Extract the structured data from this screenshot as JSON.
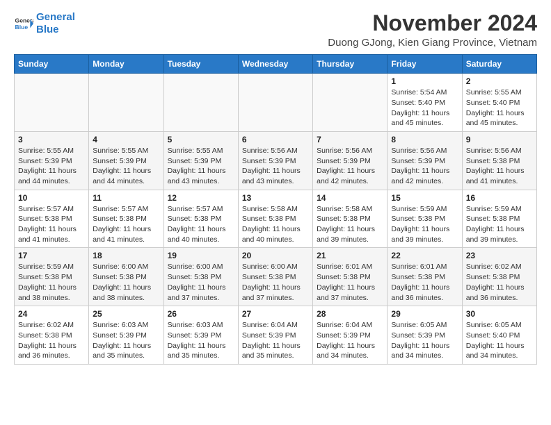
{
  "header": {
    "logo_line1": "General",
    "logo_line2": "Blue",
    "month_title": "November 2024",
    "subtitle": "Duong GJong, Kien Giang Province, Vietnam"
  },
  "weekdays": [
    "Sunday",
    "Monday",
    "Tuesday",
    "Wednesday",
    "Thursday",
    "Friday",
    "Saturday"
  ],
  "weeks": [
    [
      {
        "day": "",
        "info": ""
      },
      {
        "day": "",
        "info": ""
      },
      {
        "day": "",
        "info": ""
      },
      {
        "day": "",
        "info": ""
      },
      {
        "day": "",
        "info": ""
      },
      {
        "day": "1",
        "info": "Sunrise: 5:54 AM\nSunset: 5:40 PM\nDaylight: 11 hours and 45 minutes."
      },
      {
        "day": "2",
        "info": "Sunrise: 5:55 AM\nSunset: 5:40 PM\nDaylight: 11 hours and 45 minutes."
      }
    ],
    [
      {
        "day": "3",
        "info": "Sunrise: 5:55 AM\nSunset: 5:39 PM\nDaylight: 11 hours and 44 minutes."
      },
      {
        "day": "4",
        "info": "Sunrise: 5:55 AM\nSunset: 5:39 PM\nDaylight: 11 hours and 44 minutes."
      },
      {
        "day": "5",
        "info": "Sunrise: 5:55 AM\nSunset: 5:39 PM\nDaylight: 11 hours and 43 minutes."
      },
      {
        "day": "6",
        "info": "Sunrise: 5:56 AM\nSunset: 5:39 PM\nDaylight: 11 hours and 43 minutes."
      },
      {
        "day": "7",
        "info": "Sunrise: 5:56 AM\nSunset: 5:39 PM\nDaylight: 11 hours and 42 minutes."
      },
      {
        "day": "8",
        "info": "Sunrise: 5:56 AM\nSunset: 5:39 PM\nDaylight: 11 hours and 42 minutes."
      },
      {
        "day": "9",
        "info": "Sunrise: 5:56 AM\nSunset: 5:38 PM\nDaylight: 11 hours and 41 minutes."
      }
    ],
    [
      {
        "day": "10",
        "info": "Sunrise: 5:57 AM\nSunset: 5:38 PM\nDaylight: 11 hours and 41 minutes."
      },
      {
        "day": "11",
        "info": "Sunrise: 5:57 AM\nSunset: 5:38 PM\nDaylight: 11 hours and 41 minutes."
      },
      {
        "day": "12",
        "info": "Sunrise: 5:57 AM\nSunset: 5:38 PM\nDaylight: 11 hours and 40 minutes."
      },
      {
        "day": "13",
        "info": "Sunrise: 5:58 AM\nSunset: 5:38 PM\nDaylight: 11 hours and 40 minutes."
      },
      {
        "day": "14",
        "info": "Sunrise: 5:58 AM\nSunset: 5:38 PM\nDaylight: 11 hours and 39 minutes."
      },
      {
        "day": "15",
        "info": "Sunrise: 5:59 AM\nSunset: 5:38 PM\nDaylight: 11 hours and 39 minutes."
      },
      {
        "day": "16",
        "info": "Sunrise: 5:59 AM\nSunset: 5:38 PM\nDaylight: 11 hours and 39 minutes."
      }
    ],
    [
      {
        "day": "17",
        "info": "Sunrise: 5:59 AM\nSunset: 5:38 PM\nDaylight: 11 hours and 38 minutes."
      },
      {
        "day": "18",
        "info": "Sunrise: 6:00 AM\nSunset: 5:38 PM\nDaylight: 11 hours and 38 minutes."
      },
      {
        "day": "19",
        "info": "Sunrise: 6:00 AM\nSunset: 5:38 PM\nDaylight: 11 hours and 37 minutes."
      },
      {
        "day": "20",
        "info": "Sunrise: 6:00 AM\nSunset: 5:38 PM\nDaylight: 11 hours and 37 minutes."
      },
      {
        "day": "21",
        "info": "Sunrise: 6:01 AM\nSunset: 5:38 PM\nDaylight: 11 hours and 37 minutes."
      },
      {
        "day": "22",
        "info": "Sunrise: 6:01 AM\nSunset: 5:38 PM\nDaylight: 11 hours and 36 minutes."
      },
      {
        "day": "23",
        "info": "Sunrise: 6:02 AM\nSunset: 5:38 PM\nDaylight: 11 hours and 36 minutes."
      }
    ],
    [
      {
        "day": "24",
        "info": "Sunrise: 6:02 AM\nSunset: 5:38 PM\nDaylight: 11 hours and 36 minutes."
      },
      {
        "day": "25",
        "info": "Sunrise: 6:03 AM\nSunset: 5:39 PM\nDaylight: 11 hours and 35 minutes."
      },
      {
        "day": "26",
        "info": "Sunrise: 6:03 AM\nSunset: 5:39 PM\nDaylight: 11 hours and 35 minutes."
      },
      {
        "day": "27",
        "info": "Sunrise: 6:04 AM\nSunset: 5:39 PM\nDaylight: 11 hours and 35 minutes."
      },
      {
        "day": "28",
        "info": "Sunrise: 6:04 AM\nSunset: 5:39 PM\nDaylight: 11 hours and 34 minutes."
      },
      {
        "day": "29",
        "info": "Sunrise: 6:05 AM\nSunset: 5:39 PM\nDaylight: 11 hours and 34 minutes."
      },
      {
        "day": "30",
        "info": "Sunrise: 6:05 AM\nSunset: 5:40 PM\nDaylight: 11 hours and 34 minutes."
      }
    ]
  ]
}
